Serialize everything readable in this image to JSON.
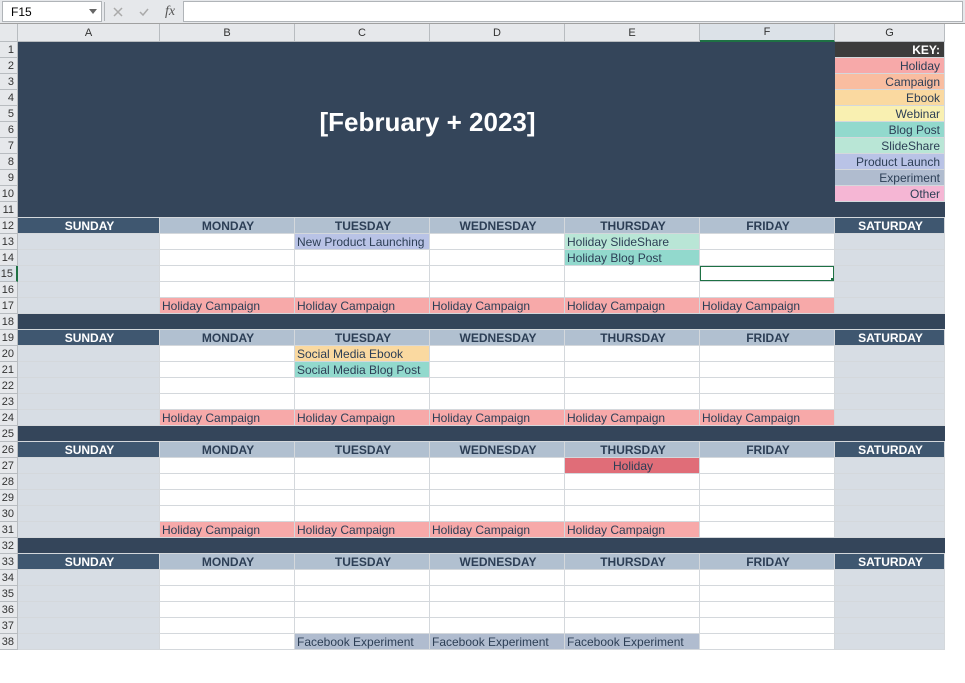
{
  "name_box": {
    "value": "F15"
  },
  "formula_bar": {
    "fx_label": "fx",
    "value": ""
  },
  "columns": [
    "A",
    "B",
    "C",
    "D",
    "E",
    "F",
    "G"
  ],
  "row_count": 38,
  "active_col": "F",
  "active_row": 15,
  "title": "[February + 2023]",
  "key_header": "KEY:",
  "legend": [
    {
      "label": "Holiday",
      "class": "bg-holiday"
    },
    {
      "label": "Campaign",
      "class": "bg-campaign"
    },
    {
      "label": "Ebook",
      "class": "bg-ebook"
    },
    {
      "label": "Webinar",
      "class": "bg-webinar"
    },
    {
      "label": "Blog Post",
      "class": "bg-blogpost"
    },
    {
      "label": "SlideShare",
      "class": "bg-slideshare"
    },
    {
      "label": "Product Launch",
      "class": "bg-launch"
    },
    {
      "label": "Experiment",
      "class": "bg-experiment"
    },
    {
      "label": "Other",
      "class": "bg-other"
    }
  ],
  "dow": [
    "SUNDAY",
    "MONDAY",
    "TUESDAY",
    "WEDNESDAY",
    "THURSDAY",
    "FRIDAY",
    "SATURDAY"
  ],
  "weeks": [
    {
      "header_row": 12,
      "rows": [
        13,
        14,
        15,
        16,
        17
      ],
      "content": {
        "13": {
          "C": {
            "text": "New Product Launching",
            "class": "bg-launch"
          },
          "E": {
            "text": "Holiday SlideShare",
            "class": "bg-slideshare"
          }
        },
        "14": {
          "E": {
            "text": "Holiday Blog Post",
            "class": "bg-blogpost"
          }
        },
        "17": {
          "B": {
            "text": "Holiday Campaign",
            "class": "bg-holiday"
          },
          "C": {
            "text": "Holiday Campaign",
            "class": "bg-holiday"
          },
          "D": {
            "text": "Holiday Campaign",
            "class": "bg-holiday"
          },
          "E": {
            "text": "Holiday Campaign",
            "class": "bg-holiday"
          },
          "F": {
            "text": "Holiday Campaign",
            "class": "bg-holiday"
          }
        }
      }
    },
    {
      "header_row": 19,
      "rows": [
        20,
        21,
        22,
        23,
        24
      ],
      "content": {
        "20": {
          "C": {
            "text": "Social Media Ebook",
            "class": "bg-ebook"
          }
        },
        "21": {
          "C": {
            "text": "Social Media Blog Post",
            "class": "bg-blogpost"
          }
        },
        "24": {
          "B": {
            "text": "Holiday Campaign",
            "class": "bg-holiday"
          },
          "C": {
            "text": "Holiday Campaign",
            "class": "bg-holiday"
          },
          "D": {
            "text": "Holiday Campaign",
            "class": "bg-holiday"
          },
          "E": {
            "text": "Holiday Campaign",
            "class": "bg-holiday"
          },
          "F": {
            "text": "Holiday Campaign",
            "class": "bg-holiday"
          }
        }
      }
    },
    {
      "header_row": 26,
      "rows": [
        27,
        28,
        29,
        30,
        31
      ],
      "content": {
        "27": {
          "E": {
            "text": "Holiday",
            "class": "bg-holiday-strong",
            "align": "center"
          }
        },
        "31": {
          "B": {
            "text": "Holiday Campaign",
            "class": "bg-holiday"
          },
          "C": {
            "text": "Holiday Campaign",
            "class": "bg-holiday"
          },
          "D": {
            "text": "Holiday Campaign",
            "class": "bg-holiday"
          },
          "E": {
            "text": "Holiday Campaign",
            "class": "bg-holiday"
          }
        }
      }
    },
    {
      "header_row": 33,
      "rows": [
        34,
        35,
        36,
        37,
        38
      ],
      "content": {
        "38": {
          "C": {
            "text": "Facebook Experiment",
            "class": "bg-experiment"
          },
          "D": {
            "text": "Facebook Experiment",
            "class": "bg-experiment"
          },
          "E": {
            "text": "Facebook Experiment",
            "class": "bg-experiment"
          }
        }
      }
    }
  ],
  "separator_rows": [
    11,
    18,
    25,
    32
  ]
}
